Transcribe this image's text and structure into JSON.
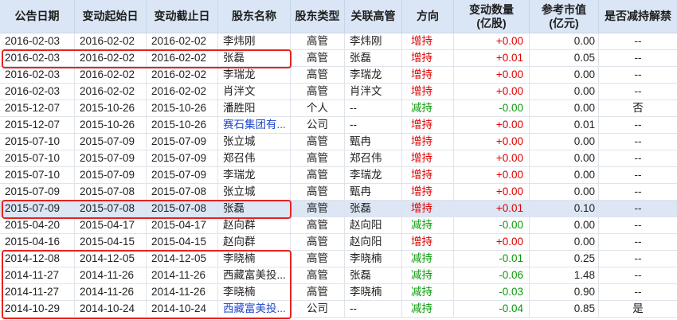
{
  "colors": {
    "header_bg": "#dae6f5",
    "increase": "#e00000",
    "decrease": "#0b9a0b",
    "link": "#1f47c9",
    "selected_row_bg": "#dce6f4",
    "annotation": "#e52421"
  },
  "table": {
    "headers": [
      {
        "label": "公告日期"
      },
      {
        "label": "变动起始日"
      },
      {
        "label": "变动截止日"
      },
      {
        "label": "股东名称"
      },
      {
        "label": "股东类型"
      },
      {
        "label": "关联高管"
      },
      {
        "label": "方向"
      },
      {
        "label": "变动数量",
        "unit": "(亿股)"
      },
      {
        "label": "参考市值",
        "unit": "(亿元)"
      },
      {
        "label": "是否减持解禁"
      }
    ],
    "rows": [
      {
        "announce_date": "2016-02-03",
        "start_date": "2016-02-02",
        "end_date": "2016-02-02",
        "holder": "李炜刚",
        "holder_type": "高管",
        "related_exec": "李炜刚",
        "direction": "增持",
        "change_qty": "+0.00",
        "market_value": "0.00",
        "reduce_unlock": "--"
      },
      {
        "announce_date": "2016-02-03",
        "start_date": "2016-02-02",
        "end_date": "2016-02-02",
        "holder": "张磊",
        "holder_type": "高管",
        "related_exec": "张磊",
        "direction": "增持",
        "change_qty": "+0.01",
        "market_value": "0.05",
        "reduce_unlock": "--"
      },
      {
        "announce_date": "2016-02-03",
        "start_date": "2016-02-02",
        "end_date": "2016-02-02",
        "holder": "李瑞龙",
        "holder_type": "高管",
        "related_exec": "李瑞龙",
        "direction": "增持",
        "change_qty": "+0.00",
        "market_value": "0.00",
        "reduce_unlock": "--"
      },
      {
        "announce_date": "2016-02-03",
        "start_date": "2016-02-02",
        "end_date": "2016-02-02",
        "holder": "肖泮文",
        "holder_type": "高管",
        "related_exec": "肖泮文",
        "direction": "增持",
        "change_qty": "+0.00",
        "market_value": "0.00",
        "reduce_unlock": "--"
      },
      {
        "announce_date": "2015-12-07",
        "start_date": "2015-10-26",
        "end_date": "2015-10-26",
        "holder": "潘胜阳",
        "holder_type": "个人",
        "related_exec": "--",
        "direction": "减持",
        "change_qty": "-0.00",
        "market_value": "0.00",
        "reduce_unlock": "否"
      },
      {
        "announce_date": "2015-12-07",
        "start_date": "2015-10-26",
        "end_date": "2015-10-26",
        "holder": "赛石集团有...",
        "holder_is_link": true,
        "holder_type": "公司",
        "related_exec": "--",
        "direction": "增持",
        "change_qty": "+0.00",
        "market_value": "0.01",
        "reduce_unlock": "--"
      },
      {
        "announce_date": "2015-07-10",
        "start_date": "2015-07-09",
        "end_date": "2015-07-09",
        "holder": "张立城",
        "holder_type": "高管",
        "related_exec": "甄冉",
        "direction": "增持",
        "change_qty": "+0.00",
        "market_value": "0.00",
        "reduce_unlock": "--"
      },
      {
        "announce_date": "2015-07-10",
        "start_date": "2015-07-09",
        "end_date": "2015-07-09",
        "holder": "郑召伟",
        "holder_type": "高管",
        "related_exec": "郑召伟",
        "direction": "增持",
        "change_qty": "+0.00",
        "market_value": "0.00",
        "reduce_unlock": "--"
      },
      {
        "announce_date": "2015-07-10",
        "start_date": "2015-07-09",
        "end_date": "2015-07-09",
        "holder": "李瑞龙",
        "holder_type": "高管",
        "related_exec": "李瑞龙",
        "direction": "增持",
        "change_qty": "+0.00",
        "market_value": "0.00",
        "reduce_unlock": "--"
      },
      {
        "announce_date": "2015-07-09",
        "start_date": "2015-07-08",
        "end_date": "2015-07-08",
        "holder": "张立城",
        "holder_type": "高管",
        "related_exec": "甄冉",
        "direction": "增持",
        "change_qty": "+0.00",
        "market_value": "0.00",
        "reduce_unlock": "--"
      },
      {
        "announce_date": "2015-07-09",
        "start_date": "2015-07-08",
        "end_date": "2015-07-08",
        "holder": "张磊",
        "holder_type": "高管",
        "related_exec": "张磊",
        "direction": "增持",
        "change_qty": "+0.01",
        "market_value": "0.10",
        "reduce_unlock": "--",
        "selected": true
      },
      {
        "announce_date": "2015-04-20",
        "start_date": "2015-04-17",
        "end_date": "2015-04-17",
        "holder": "赵向群",
        "holder_type": "高管",
        "related_exec": "赵向阳",
        "direction": "减持",
        "change_qty": "-0.00",
        "market_value": "0.00",
        "reduce_unlock": "--"
      },
      {
        "announce_date": "2015-04-16",
        "start_date": "2015-04-15",
        "end_date": "2015-04-15",
        "holder": "赵向群",
        "holder_type": "高管",
        "related_exec": "赵向阳",
        "direction": "增持",
        "change_qty": "+0.00",
        "market_value": "0.00",
        "reduce_unlock": "--"
      },
      {
        "announce_date": "2014-12-08",
        "start_date": "2014-12-05",
        "end_date": "2014-12-05",
        "holder": "李晓楠",
        "holder_type": "高管",
        "related_exec": "李晓楠",
        "direction": "减持",
        "change_qty": "-0.01",
        "market_value": "0.25",
        "reduce_unlock": "--"
      },
      {
        "announce_date": "2014-11-27",
        "start_date": "2014-11-26",
        "end_date": "2014-11-26",
        "holder": "西藏富美投...",
        "holder_type": "高管",
        "related_exec": "张磊",
        "direction": "减持",
        "change_qty": "-0.06",
        "market_value": "1.48",
        "reduce_unlock": "--"
      },
      {
        "announce_date": "2014-11-27",
        "start_date": "2014-11-26",
        "end_date": "2014-11-26",
        "holder": "李晓楠",
        "holder_type": "高管",
        "related_exec": "李晓楠",
        "direction": "减持",
        "change_qty": "-0.03",
        "market_value": "0.90",
        "reduce_unlock": "--"
      },
      {
        "announce_date": "2014-10-29",
        "start_date": "2014-10-24",
        "end_date": "2014-10-24",
        "holder": "西藏富美投...",
        "holder_is_link": true,
        "holder_type": "公司",
        "related_exec": "--",
        "direction": "减持",
        "change_qty": "-0.04",
        "market_value": "0.85",
        "reduce_unlock": "是"
      }
    ],
    "highlight_boxes": [
      {
        "first_row": 1,
        "last_row": 1
      },
      {
        "first_row": 10,
        "last_row": 10
      },
      {
        "first_row": 13,
        "last_row": 16
      }
    ]
  }
}
